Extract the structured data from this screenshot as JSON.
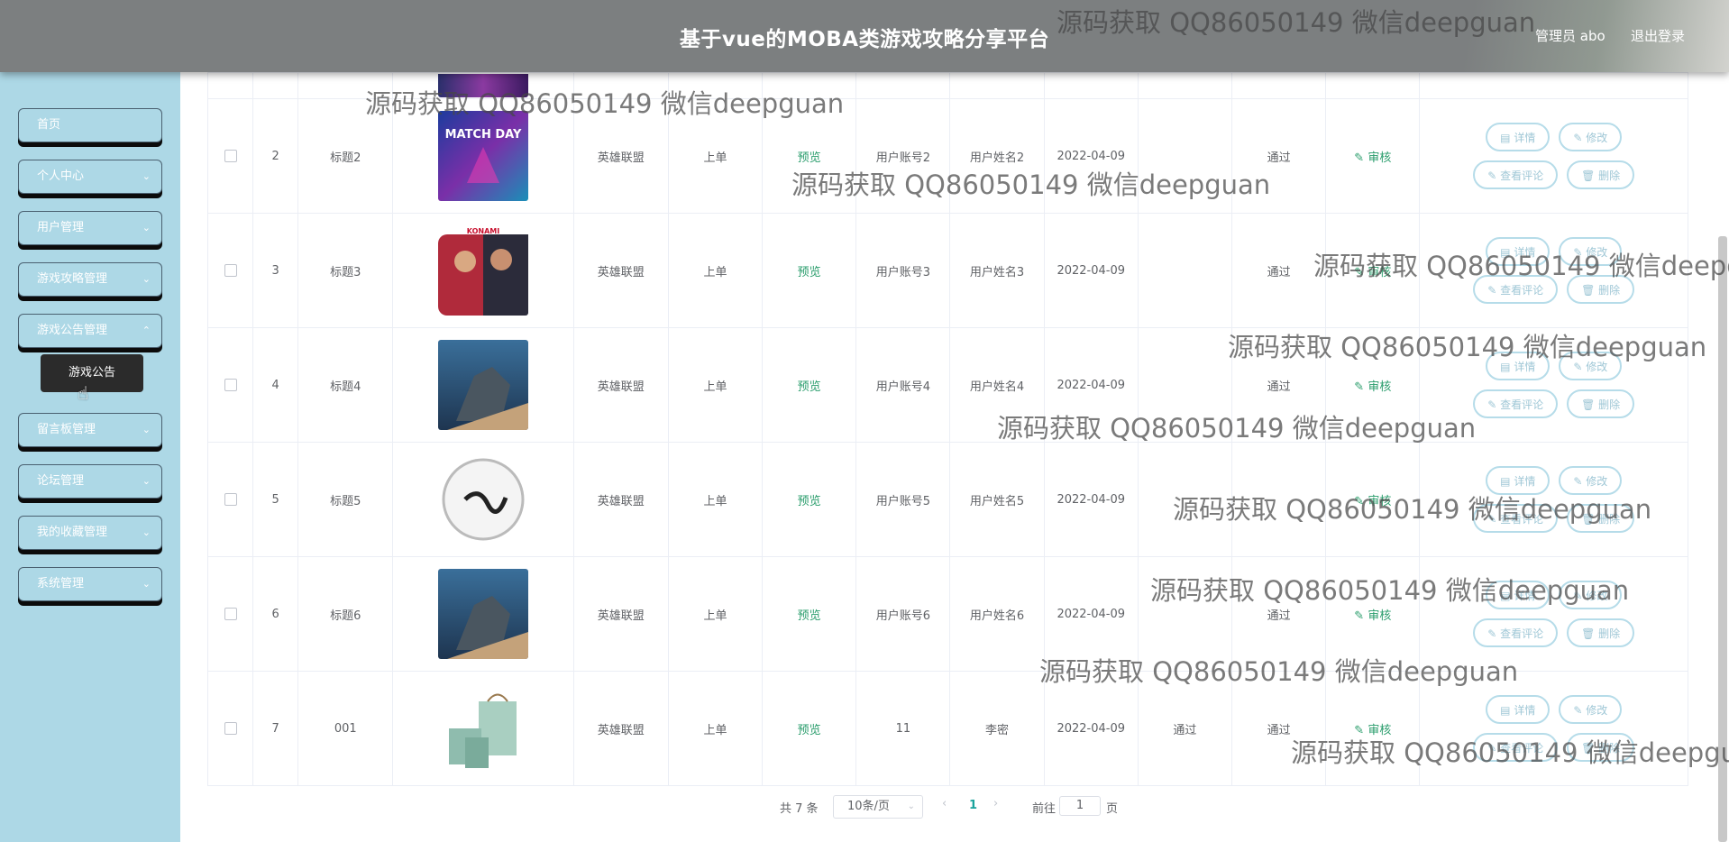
{
  "header": {
    "title": "基于vue的MOBA类游戏攻略分享平台",
    "admin": "管理员 abo",
    "logout": "退出登录"
  },
  "sidebar": {
    "items": [
      {
        "label": "首页",
        "has_arrow": false
      },
      {
        "label": "个人中心",
        "has_arrow": true
      },
      {
        "label": "用户管理",
        "has_arrow": true
      },
      {
        "label": "游戏攻略管理",
        "has_arrow": true
      },
      {
        "label": "游戏公告管理",
        "has_arrow": true
      },
      {
        "label": "留言板管理",
        "has_arrow": true
      },
      {
        "label": "论坛管理",
        "has_arrow": true
      },
      {
        "label": "我的收藏管理",
        "has_arrow": true
      },
      {
        "label": "系统管理",
        "has_arrow": true
      }
    ],
    "open_submenu": "游戏公告"
  },
  "table": {
    "preview_label": "预览",
    "audit_label": "审核",
    "buttons": {
      "detail": "详情",
      "edit": "修改",
      "comments": "查看评论",
      "delete": "删除"
    },
    "rows": [
      {
        "idx": "2",
        "title": "标题2",
        "category": "英雄联盟",
        "type": "上单",
        "account": "用户账号2",
        "name": "用户姓名2",
        "date": "2022-04-09",
        "status1": "",
        "status2": "通过",
        "thumb": "matchday"
      },
      {
        "idx": "3",
        "title": "标题3",
        "category": "英雄联盟",
        "type": "上单",
        "account": "用户账号3",
        "name": "用户姓名3",
        "date": "2022-04-09",
        "status1": "",
        "status2": "通过",
        "thumb": "football"
      },
      {
        "idx": "4",
        "title": "标题4",
        "category": "英雄联盟",
        "type": "上单",
        "account": "用户账号4",
        "name": "用户姓名4",
        "date": "2022-04-09",
        "status1": "",
        "status2": "通过",
        "thumb": "dragon"
      },
      {
        "idx": "5",
        "title": "标题5",
        "category": "英雄联盟",
        "type": "上单",
        "account": "用户账号5",
        "name": "用户姓名5",
        "date": "2022-04-09",
        "status1": "",
        "status2": "",
        "thumb": "logo"
      },
      {
        "idx": "6",
        "title": "标题6",
        "category": "英雄联盟",
        "type": "上单",
        "account": "用户账号6",
        "name": "用户姓名6",
        "date": "2022-04-09",
        "status1": "",
        "status2": "通过",
        "thumb": "dragon"
      },
      {
        "idx": "7",
        "title": "001",
        "category": "英雄联盟",
        "type": "上单",
        "account": "11",
        "name": "李密",
        "date": "2022-04-09",
        "status1": "通过",
        "status2": "通过",
        "thumb": "tea"
      }
    ]
  },
  "pagination": {
    "total": "共 7 条",
    "page_size": "10条/页",
    "current": "1",
    "goto_label": "前往",
    "goto_value": "1",
    "page_suffix": "页"
  },
  "watermark": "源码获取 QQ86050149 微信deepguan",
  "colors": {
    "header": "#7c7f80",
    "sidebar": "#add8e6",
    "accent_green": "#2a9d6c",
    "button_border": "#b6dce9"
  }
}
